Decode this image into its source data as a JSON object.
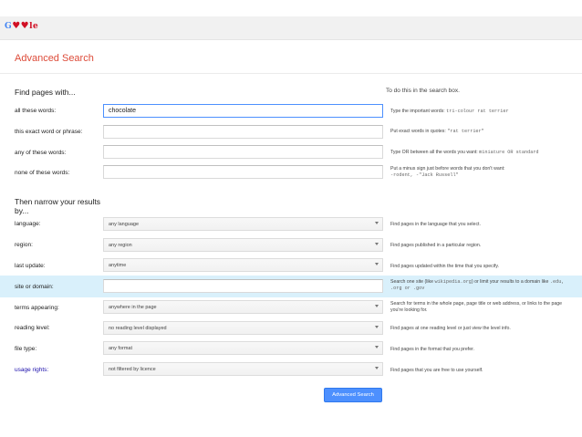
{
  "header": {
    "logo_text": "G",
    "logo_hearts": "♥♥",
    "logo_tail": "le"
  },
  "page": {
    "title": "Advanced Search"
  },
  "find": {
    "heading": "Find pages with...",
    "todo_heading": "To do this in the search box.",
    "rows": [
      {
        "label": "all these words:",
        "value": "chocolate",
        "help_pre": "Type the important words: ",
        "help_mono": "tri-colour rat terrier",
        "help_post": ""
      },
      {
        "label": "this exact word or phrase:",
        "value": "",
        "help_pre": "Put exact words in quotes: ",
        "help_mono": "\"rat terrier\"",
        "help_post": ""
      },
      {
        "label": "any of these words:",
        "value": "",
        "help_pre": "Type OR between all the words you want: ",
        "help_mono": "miniature OR standard",
        "help_post": ""
      },
      {
        "label": "none of these words:",
        "value": "",
        "help_pre": "Put a minus sign just before words that you don't want:",
        "help_mono": "-rodent, -\"Jack Russell\"",
        "help_post": ""
      }
    ]
  },
  "narrow": {
    "heading_line1": "Then narrow your results",
    "heading_line2": "by...",
    "rows": [
      {
        "label": "language:",
        "value": "any language",
        "help": "Find pages in the language that you select."
      },
      {
        "label": "region:",
        "value": "any region",
        "help": "Find pages published in a particular region."
      },
      {
        "label": "last update:",
        "value": "anytime",
        "help": "Find pages updated within the time that you specify."
      },
      {
        "label": "site or domain:",
        "value": "",
        "help_pre": "Search one site (like ",
        "help_mono1": "wikipedia.org",
        "help_mid": ") or limit your results to a domain like ",
        "help_mono2": ".edu, .org or .gov"
      },
      {
        "label": "terms appearing:",
        "value": "anywhere in the page",
        "help": "Search for terms in the whole page, page title or web address, or links to the page you're looking for."
      },
      {
        "label": "reading level:",
        "value": "no reading level displayed",
        "help": "Find pages at one reading level or just view the level info."
      },
      {
        "label": "file type:",
        "value": "any format",
        "help": "Find pages in the format that you prefer."
      },
      {
        "label": "usage rights:",
        "value": "not filtered by licence",
        "help": "Find pages that you are free to use yourself."
      }
    ]
  },
  "submit_label": "Advanced Search",
  "colors": {
    "accent": "#dd4b39",
    "button": "#4d90fe",
    "highlight": "#d9f0fb",
    "link": "#1a0dab"
  }
}
